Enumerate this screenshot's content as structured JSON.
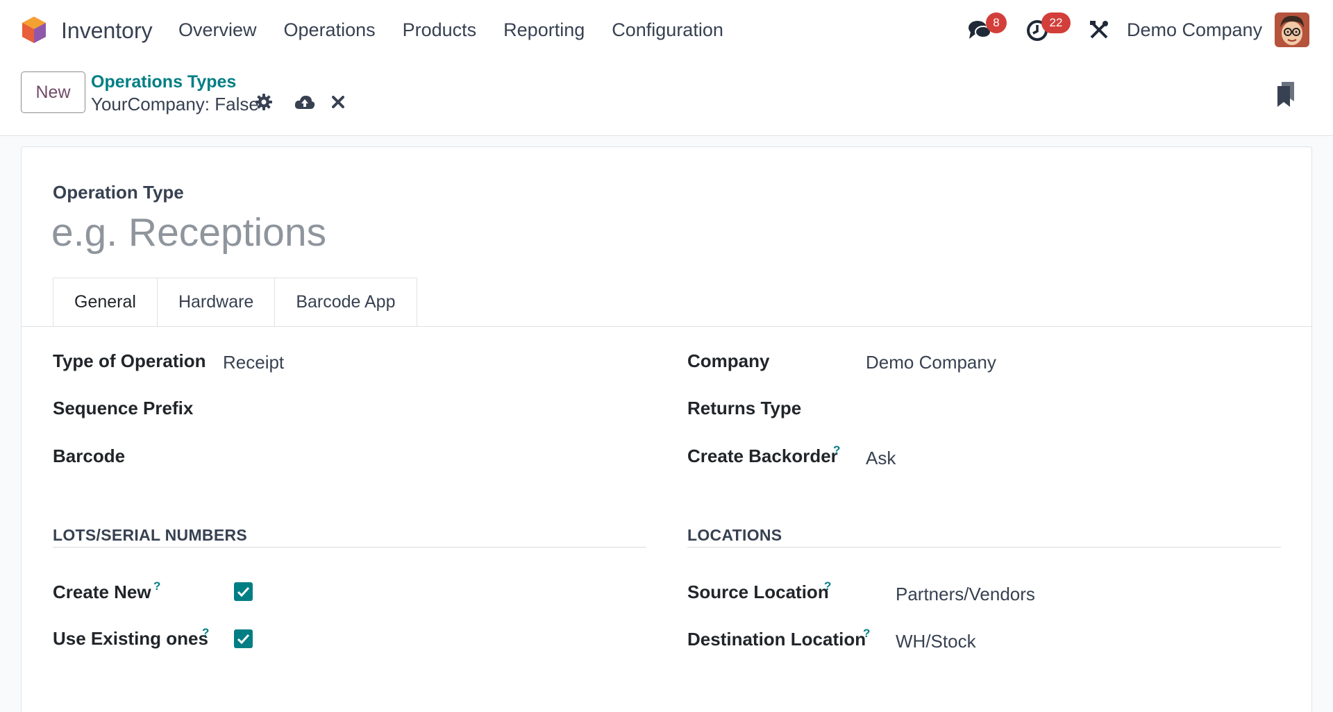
{
  "navbar": {
    "app_name": "Inventory",
    "menu": [
      "Overview",
      "Operations",
      "Products",
      "Reporting",
      "Configuration"
    ],
    "messages_badge": "8",
    "activities_badge": "22",
    "company": "Demo Company"
  },
  "control_panel": {
    "new_label": "New",
    "breadcrumb_parent": "Operations Types",
    "record_title": "YourCompany: False"
  },
  "form": {
    "name_label": "Operation Type",
    "name_placeholder": "e.g. Receptions",
    "tabs": [
      "General",
      "Hardware",
      "Barcode App"
    ],
    "left": {
      "type_of_operation_label": "Type of Operation",
      "type_of_operation_value": "Receipt",
      "sequence_prefix_label": "Sequence Prefix",
      "barcode_label": "Barcode"
    },
    "right": {
      "company_label": "Company",
      "company_value": "Demo Company",
      "returns_type_label": "Returns Type",
      "create_backorder_label": "Create Backorder",
      "create_backorder_value": "Ask"
    },
    "lots": {
      "title": "LOTS/SERIAL NUMBERS",
      "create_new_label": "Create New",
      "create_new_checked": true,
      "use_existing_label": "Use Existing ones",
      "use_existing_checked": true
    },
    "locations": {
      "title": "LOCATIONS",
      "source_label": "Source Location",
      "source_value": "Partners/Vendors",
      "destination_label": "Destination Location",
      "destination_value": "WH/Stock"
    },
    "help_mark": "?"
  },
  "colors": {
    "accent": "#017e84",
    "brand": "#714b67",
    "badge": "#d23f3a"
  }
}
